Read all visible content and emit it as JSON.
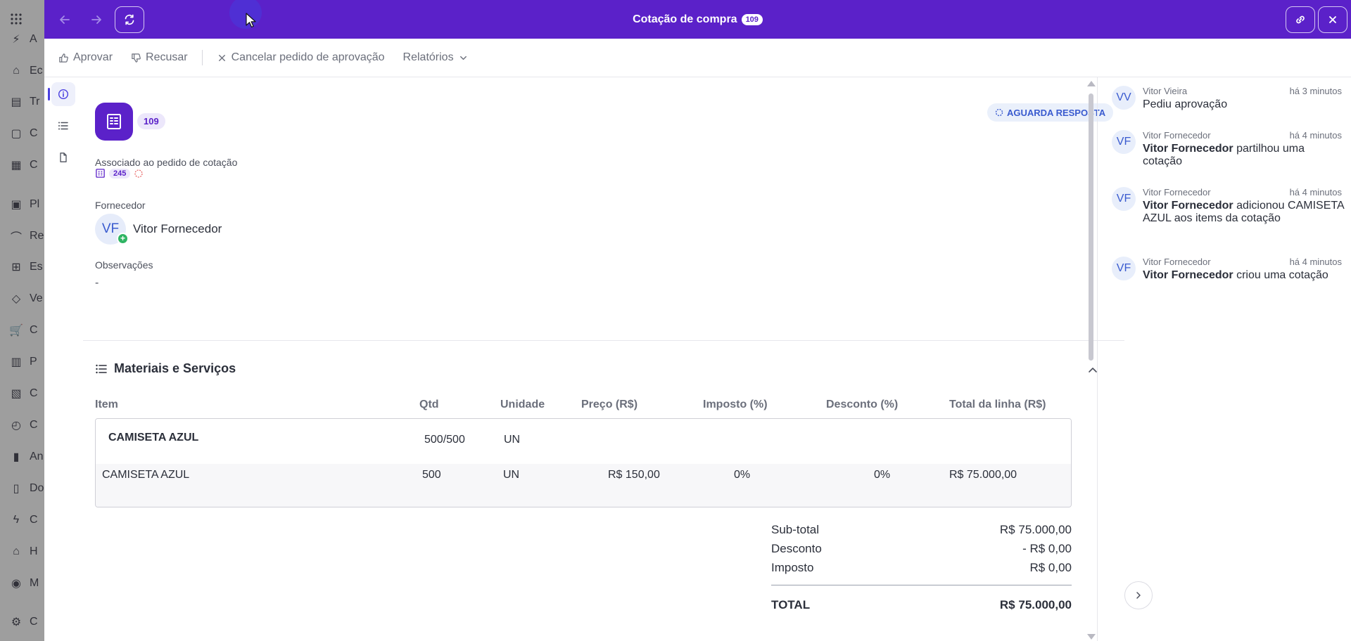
{
  "background": {
    "sidebar_items": [
      "A",
      "Ec",
      "Tr",
      "C",
      "C",
      "Pl",
      "Re",
      "Es",
      "Ve",
      "C",
      "P",
      "C",
      "C",
      "An",
      "Do",
      "C",
      "H",
      "M",
      "C"
    ]
  },
  "window": {
    "title": "Cotação de compra",
    "title_badge": "109"
  },
  "actions": {
    "approve": "Aprovar",
    "refuse": "Recusar",
    "cancel": "Cancelar pedido de aprovação",
    "reports": "Relatórios"
  },
  "header": {
    "doc_number": "109",
    "status": "AGUARDA RESPOSTA"
  },
  "details": {
    "associated_label": "Associado ao pedido de cotação",
    "associated_number": "245",
    "supplier_label": "Fornecedor",
    "supplier_initials": "VF",
    "supplier_name": "Vitor Fornecedor",
    "notes_label": "Observações",
    "notes_value": "-"
  },
  "materials": {
    "title": "Materiais e Serviços",
    "columns": [
      "Item",
      "Qtd",
      "Unidade",
      "Preço (R$)",
      "Imposto (%)",
      "Desconto (%)",
      "Total da linha (R$)"
    ],
    "group": {
      "name": "CAMISETA AZUL",
      "qty": "500/500",
      "unit": "UN"
    },
    "rows": [
      {
        "item": "CAMISETA AZUL",
        "qty": "500",
        "unit": "UN",
        "price": "R$ 150,00",
        "tax": "0%",
        "discount": "0%",
        "total": "R$ 75.000,00"
      }
    ]
  },
  "totals": {
    "subtotal_label": "Sub-total",
    "subtotal": "R$ 75.000,00",
    "discount_label": "Desconto",
    "discount": "- R$ 0,00",
    "tax_label": "Imposto",
    "tax": "R$ 0,00",
    "total_label": "TOTAL",
    "total": "R$ 75.000,00"
  },
  "activity": [
    {
      "initials": "VV",
      "user": "Vitor Vieira",
      "time": "há 3 minutos",
      "bold": "",
      "text": "Pediu aprovação"
    },
    {
      "initials": "VF",
      "user": "Vitor Fornecedor",
      "time": "há 4 minutos",
      "bold": "Vitor Fornecedor",
      "text": " partilhou uma cotação"
    },
    {
      "initials": "VF",
      "user": "Vitor Fornecedor",
      "time": "há 4 minutos",
      "bold": "Vitor Fornecedor",
      "text": " adicionou CAMISETA AZUL aos items da cotação"
    },
    {
      "initials": "VF",
      "user": "Vitor Fornecedor",
      "time": "há 4 minutos",
      "bold": "Vitor Fornecedor",
      "text": " criou uma cotação"
    }
  ],
  "colors": {
    "brand": "#5b21c9",
    "status_bg": "#eaf0fb",
    "status_text": "#3a5bcf"
  }
}
